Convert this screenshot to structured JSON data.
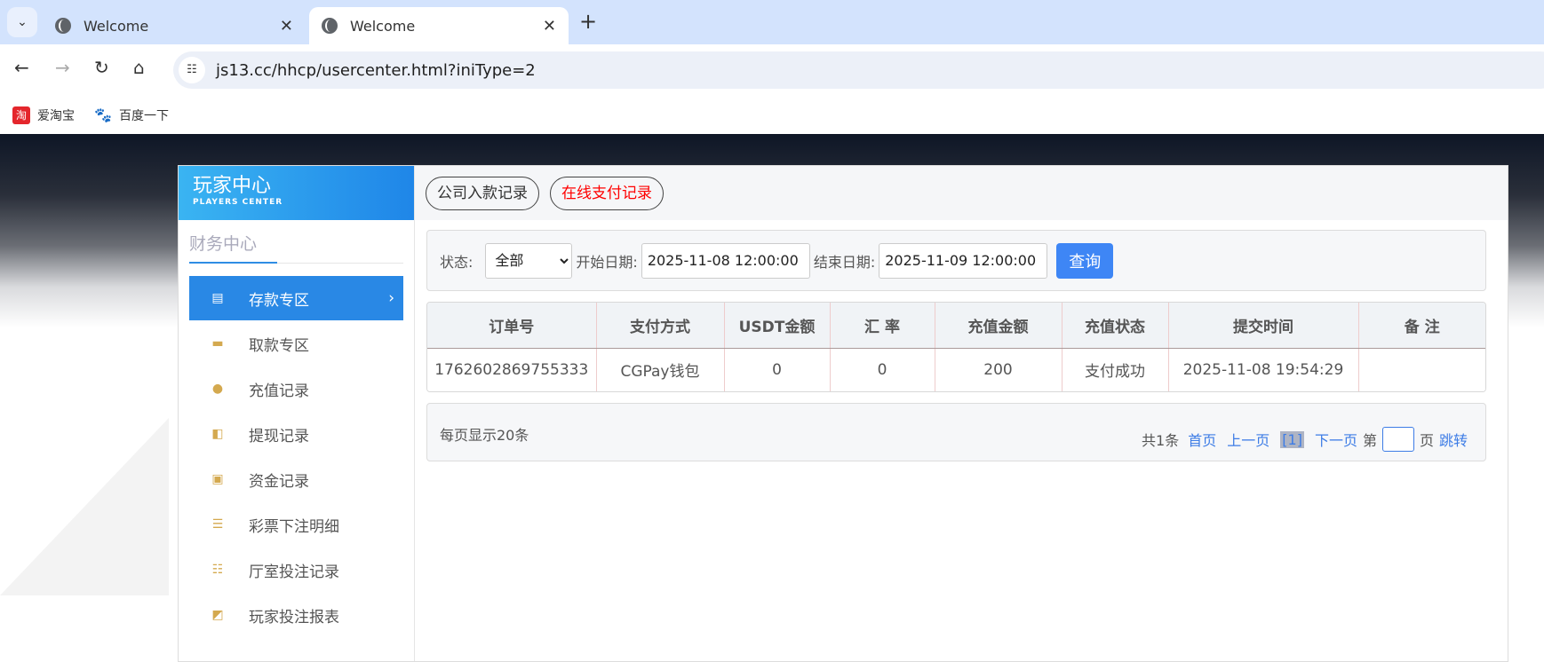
{
  "browser": {
    "tabs": [
      {
        "title": "Welcome",
        "active": false
      },
      {
        "title": "Welcome",
        "active": true
      }
    ],
    "url": "js13.cc/hhcp/usercenter.html?iniType=2",
    "bookmarks": [
      {
        "label": "爱淘宝",
        "icon": "taobao-icon"
      },
      {
        "label": "百度一下",
        "icon": "baidu-icon"
      }
    ]
  },
  "sidebar": {
    "title": "玩家中心",
    "subtitle": "PLAYERS CENTER",
    "section": "财务中心",
    "items": [
      {
        "label": "存款专区",
        "icon": "card-icon",
        "active": true
      },
      {
        "label": "取款专区",
        "icon": "hand-money-icon"
      },
      {
        "label": "充值记录",
        "icon": "money-bag-icon"
      },
      {
        "label": "提现记录",
        "icon": "wallet-icon"
      },
      {
        "label": "资金记录",
        "icon": "cash-icon"
      },
      {
        "label": "彩票下注明细",
        "icon": "list-card-icon"
      },
      {
        "label": "厅室投注记录",
        "icon": "list-icon"
      },
      {
        "label": "玩家投注报表",
        "icon": "chart-icon"
      }
    ]
  },
  "tabs": [
    {
      "label": "公司入款记录",
      "color": "#333333"
    },
    {
      "label": "在线支付记录",
      "color": "#ff0000"
    }
  ],
  "filter": {
    "status_label": "状态:",
    "status_value": "全部",
    "start_label": "开始日期:",
    "start_value": "2025-11-08 12:00:00",
    "end_label": "结束日期:",
    "end_value": "2025-11-09 12:00:00",
    "query": "查询"
  },
  "table": {
    "headers": [
      "订单号",
      "支付方式",
      "USDT金额",
      "汇 率",
      "充值金额",
      "充值状态",
      "提交时间",
      "备 注"
    ],
    "rows": [
      [
        "1762602869755333",
        "CGPay钱包",
        "0",
        "0",
        "200",
        "支付成功",
        "2025-11-08 19:54:29",
        ""
      ]
    ]
  },
  "pager": {
    "per_page": "每页显示20条",
    "total": "共1条",
    "first": "首页",
    "prev": "上一页",
    "current": "[1]",
    "next": "下一页",
    "page_prefix": "第",
    "page_suffix": "页",
    "jump": "跳转"
  },
  "colors": {
    "accent": "#2988e5",
    "query_button": "#3e86f5",
    "link": "#3d7ce6"
  }
}
